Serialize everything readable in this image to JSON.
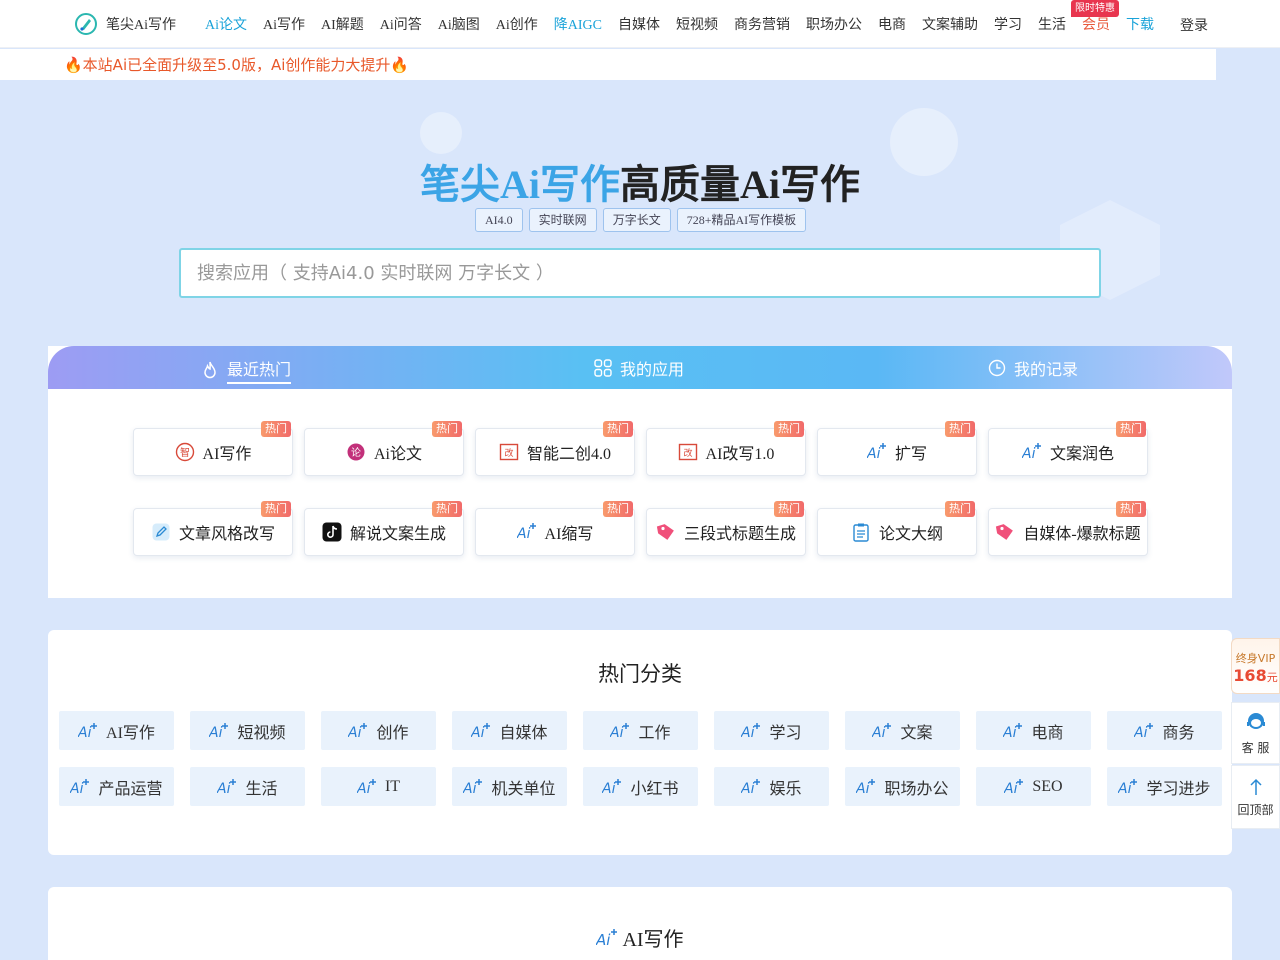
{
  "nav": {
    "logo_text": "笔尖Ai写作",
    "items": [
      "Ai论文",
      "Ai写作",
      "AI解题",
      "Ai问答",
      "Ai脑图",
      "Ai创作",
      "降AIGC",
      "自媒体",
      "短视频",
      "商务营销",
      "职场办公",
      "电商",
      "文案辅助",
      "学习",
      "生活",
      "会员",
      "下载"
    ],
    "promo_tag": "限时特惠",
    "login": "登录"
  },
  "announcement": "🔥本站Ai已全面升级至5.0版，Ai创作能力大提升🔥",
  "hero": {
    "title_brand": "笔尖Ai写作",
    "title_rest": "高质量Ai写作",
    "tags": [
      "AI4.0",
      "实时联网",
      "万字长文",
      "728+精品AI写作模板"
    ],
    "search_placeholder": "搜索应用（ 支持Ai4.0 实时联网 万字长文 ）"
  },
  "tabs": [
    {
      "label": "最近热门",
      "icon": "fire-icon"
    },
    {
      "label": "我的应用",
      "icon": "apps-grid-icon"
    },
    {
      "label": "我的记录",
      "icon": "clock-icon"
    }
  ],
  "hot_badge": "热门",
  "apps": [
    {
      "label": "AI写作",
      "icon": "ai-write-icon"
    },
    {
      "label": "Ai论文",
      "icon": "paper-icon"
    },
    {
      "label": "智能二创4.0",
      "icon": "rewrite-icon"
    },
    {
      "label": "AI改写1.0",
      "icon": "rewrite-icon"
    },
    {
      "label": "扩写",
      "icon": "ai-sparkle-icon"
    },
    {
      "label": "文案润色",
      "icon": "ai-sparkle-icon"
    },
    {
      "label": "文章风格改写",
      "icon": "edit-icon"
    },
    {
      "label": "解说文案生成",
      "icon": "tiktok-icon"
    },
    {
      "label": "AI缩写",
      "icon": "ai-sparkle-icon"
    },
    {
      "label": "三段式标题生成",
      "icon": "tag-icon"
    },
    {
      "label": "论文大纲",
      "icon": "clipboard-icon"
    },
    {
      "label": "自媒体-爆款标题",
      "icon": "tag-icon"
    }
  ],
  "categories": {
    "title": "热门分类",
    "items": [
      "AI写作",
      "短视频",
      "创作",
      "自媒体",
      "工作",
      "学习",
      "文案",
      "电商",
      "商务",
      "产品运营",
      "生活",
      "IT",
      "机关单位",
      "小红书",
      "娱乐",
      "职场办公",
      "SEO",
      "学习进步"
    ]
  },
  "section": {
    "title": "AI写作"
  },
  "float": {
    "vip_label": "终身VIP",
    "vip_price": "168",
    "vip_unit": "元",
    "service": "客 服",
    "top": "回顶部"
  },
  "colors": {
    "accent": "#1aa3d9",
    "brand_blue": "#3ba4e6",
    "hot_badge": "#f16a6a",
    "announcement": "#e8582a",
    "vip": "#e84a33"
  }
}
